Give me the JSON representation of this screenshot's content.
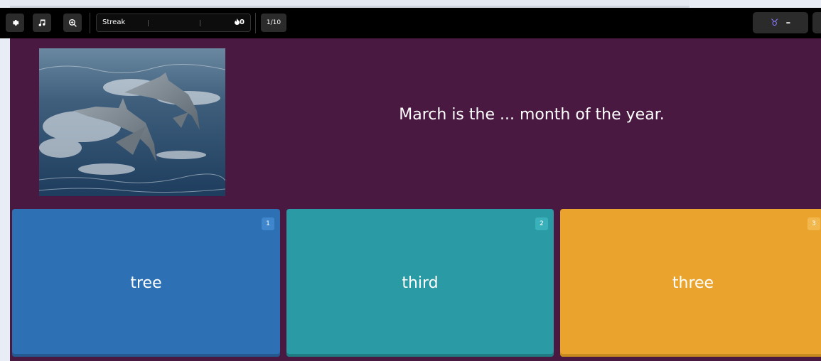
{
  "toolbar": {
    "settings_icon": "gear-icon",
    "music_icon": "music-note-icon",
    "zoom_icon": "zoom-in-icon",
    "streak_label": "Streak",
    "streak_count": "0",
    "streak_icon": "flame-icon",
    "question_counter": "1/10",
    "powerup_icon": "taurus-icon",
    "powerup_value": "–"
  },
  "question": {
    "text": "March is the ... month of the year.",
    "image_subject": "dolphins-image"
  },
  "options": [
    {
      "number": "1",
      "label": "tree",
      "color": "#2d70b3",
      "badge_color": "#3f86cc",
      "shadow": "#245a90"
    },
    {
      "number": "2",
      "label": "third",
      "color": "#2a9ba4",
      "badge_color": "#3ab0ba",
      "shadow": "#1f7c84"
    },
    {
      "number": "3",
      "label": "three",
      "color": "#eaa42e",
      "badge_color": "#f2b84e",
      "shadow": "#c98a1f"
    }
  ],
  "colors": {
    "question_bg": "#4a1942",
    "toolbar_bg": "#000000"
  }
}
